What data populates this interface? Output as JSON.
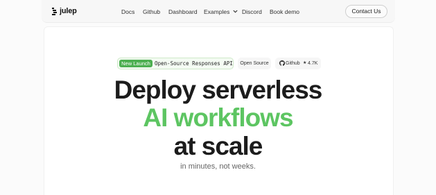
{
  "nav": {
    "brand": "julep",
    "links": [
      {
        "label": "Docs"
      },
      {
        "label": "Github"
      },
      {
        "label": "Dashboard"
      },
      {
        "label": "Examples"
      },
      {
        "label": "Discord"
      },
      {
        "label": "Book demo"
      }
    ],
    "examples_icon": "chevron-down-icon",
    "contact_label": "Contact Us"
  },
  "badges": {
    "launch_tag": "New Launch",
    "launch_text": "Open-Source Responses API",
    "open_source": "Open Source",
    "github_label": "Github",
    "github_icon": "github-icon",
    "star_icon": "★",
    "github_stars": "4.7K"
  },
  "hero": {
    "line1": "Deploy serverless",
    "line2": "AI workflows",
    "line3": "at scale",
    "subtitle": "in minutes, not weeks."
  },
  "colors": {
    "accent_green": "#5dc562",
    "badge_green": "#4caf50",
    "text_dark": "#1c1c1c"
  }
}
